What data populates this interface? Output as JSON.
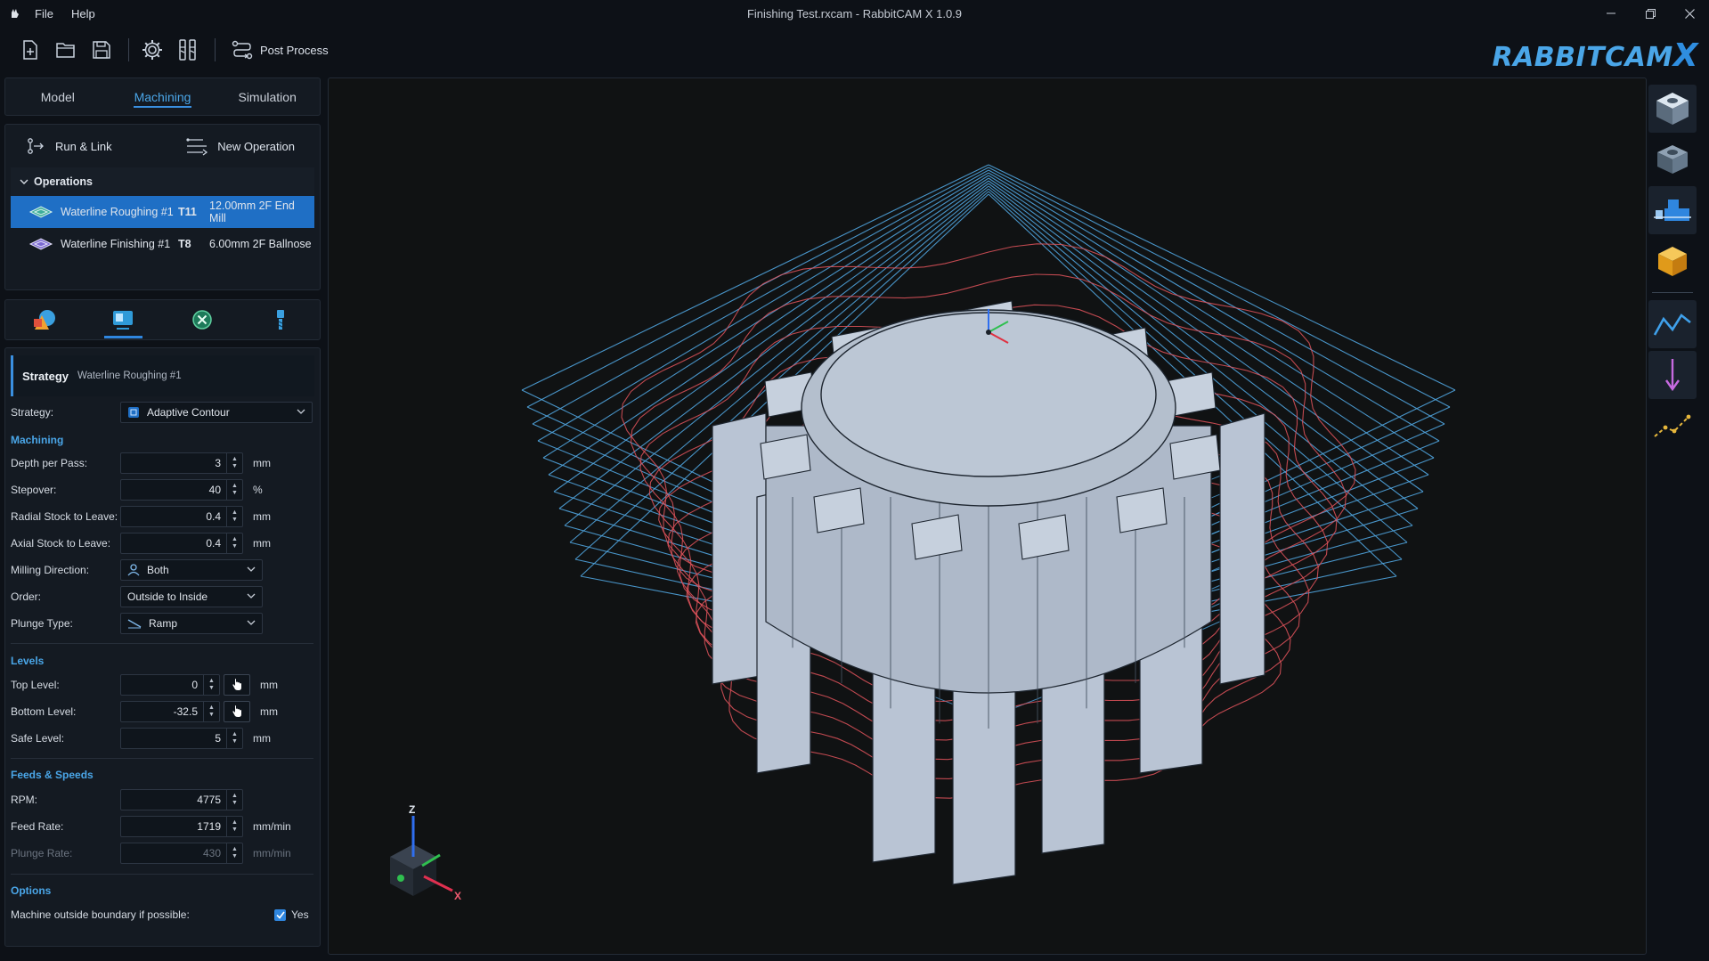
{
  "window": {
    "title": "Finishing Test.rxcam - RabbitCAM X 1.0.9",
    "menu": [
      "File",
      "Help"
    ]
  },
  "toolbar": {
    "post_process_label": "Post Process",
    "brand_main": "RABBITCAM",
    "brand_x": "X"
  },
  "tabs": [
    "Model",
    "Machining",
    "Simulation"
  ],
  "active_tab": "Machining",
  "operations": {
    "run_link_label": "Run & Link",
    "new_operation_label": "New Operation",
    "header": "Operations",
    "items": [
      {
        "name": "Waterline Roughing #1",
        "tool": "T11",
        "tool_desc": "12.00mm 2F End Mill",
        "selected": true
      },
      {
        "name": "Waterline Finishing #1",
        "tool": "T8",
        "tool_desc": "6.00mm 2F Ballnose",
        "selected": false
      }
    ]
  },
  "properties": {
    "heading": "Strategy",
    "subheading": "Waterline Roughing #1",
    "strategy_label": "Strategy:",
    "strategy_value": "Adaptive Contour",
    "sections": {
      "machining": "Machining",
      "levels": "Levels",
      "feeds": "Feeds & Speeds",
      "options": "Options"
    },
    "depth_per_pass": {
      "label": "Depth per Pass:",
      "value": "3",
      "unit": "mm"
    },
    "stepover": {
      "label": "Stepover:",
      "value": "40",
      "unit": "%"
    },
    "radial_stock": {
      "label": "Radial Stock to Leave:",
      "value": "0.4",
      "unit": "mm"
    },
    "axial_stock": {
      "label": "Axial Stock to Leave:",
      "value": "0.4",
      "unit": "mm"
    },
    "milling_direction": {
      "label": "Milling Direction:",
      "value": "Both"
    },
    "order": {
      "label": "Order:",
      "value": "Outside to Inside"
    },
    "plunge_type": {
      "label": "Plunge Type:",
      "value": "Ramp"
    },
    "top_level": {
      "label": "Top Level:",
      "value": "0",
      "unit": "mm"
    },
    "bottom_level": {
      "label": "Bottom Level:",
      "value": "-32.5",
      "unit": "mm"
    },
    "safe_level": {
      "label": "Safe Level:",
      "value": "5",
      "unit": "mm"
    },
    "rpm": {
      "label": "RPM:",
      "value": "4775"
    },
    "feed_rate": {
      "label": "Feed Rate:",
      "value": "1719",
      "unit": "mm/min"
    },
    "plunge_rate": {
      "label": "Plunge Rate:",
      "value": "430",
      "unit": "mm/min"
    },
    "machine_outside": {
      "label": "Machine outside boundary if possible:",
      "value": "Yes",
      "checked": true
    }
  },
  "viewport": {
    "axis_labels": {
      "z": "Z",
      "x": "X"
    },
    "toolpath_colors": {
      "roughing": "#4fa3dc",
      "finishing": "#e0545c"
    },
    "part_color": "#b9c4d4"
  },
  "right_toolbar": [
    "top-view-icon",
    "iso-view-icon",
    "stock-view-icon",
    "solid-view-icon",
    "toolpath-display-icon",
    "plunge-display-icon",
    "link-display-icon"
  ]
}
